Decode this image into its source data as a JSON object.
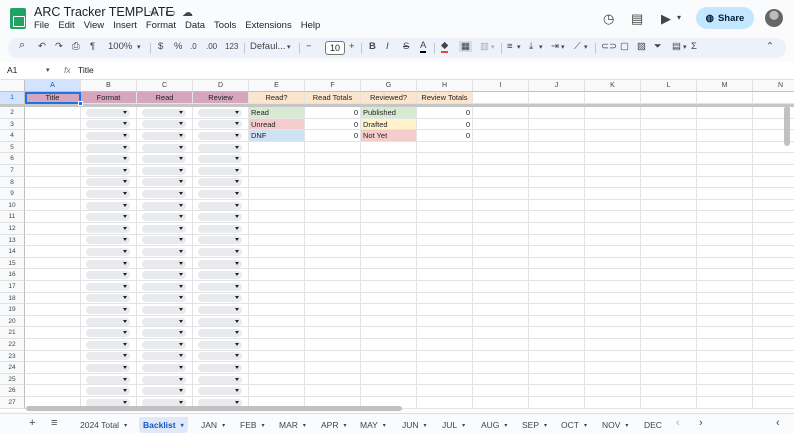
{
  "app": {
    "title": "ARC Tracker TEMPLATE",
    "menu": [
      "File",
      "Edit",
      "View",
      "Insert",
      "Format",
      "Data",
      "Tools",
      "Extensions",
      "Help"
    ],
    "share_label": "Share"
  },
  "icons": {
    "star": "☆",
    "folder": "▭",
    "cloud": "☁",
    "history": "◷",
    "comment": "▤",
    "video": "▶",
    "globe": "◍",
    "search": "⌕",
    "undo": "↶",
    "redo": "↷",
    "print": "⎙",
    "paint_format": "¶",
    "chevron_down": "▾",
    "chevron_up": "⌃",
    "chevron_left": "‹",
    "chevron_right": "›",
    "menu": "≡",
    "plus": "+"
  },
  "toolbar": {
    "zoom": "100%",
    "currency": "$",
    "percent": "%",
    "decimal_decrease": ".0",
    "decimal_increase": ".00",
    "number_format": "123",
    "font": "Defaul...",
    "font_size": "10",
    "minus": "−",
    "plus": "+",
    "bold": "B",
    "italic": "I",
    "strike": "S",
    "text_color": "A",
    "sum": "Σ"
  },
  "formula_bar": {
    "cell_ref": "A1",
    "fx": "fx",
    "content": "Title"
  },
  "grid": {
    "columns": [
      "A",
      "B",
      "C",
      "D",
      "E",
      "F",
      "G",
      "H",
      "I",
      "J",
      "K",
      "L",
      "M",
      "N"
    ],
    "rows": [
      "1",
      "2",
      "3",
      "4",
      "5",
      "6",
      "7",
      "8",
      "9",
      "10",
      "11",
      "12",
      "13",
      "14",
      "15",
      "16",
      "17",
      "18",
      "19",
      "20",
      "21",
      "22",
      "23",
      "24",
      "25",
      "26",
      "27"
    ],
    "headers": {
      "A": "Title",
      "B": "Format",
      "C": "Read",
      "D": "Review",
      "E": "Read?",
      "F": "Read Totals",
      "G": "Reviewed?",
      "H": "Review Totals"
    },
    "status": [
      {
        "label": "Read",
        "total": "0",
        "review_label": "Published",
        "review_total": "0"
      },
      {
        "label": "Unread",
        "total": "0",
        "review_label": "Drafted",
        "review_total": "0"
      },
      {
        "label": "DNF",
        "total": "0",
        "review_label": "Not Yet",
        "review_total": "0"
      }
    ]
  },
  "colors": {
    "hdr_purple": "#d5a6bd",
    "hdr_peach": "#fce5cd",
    "read_green": "#d9ead3",
    "unread_red": "#f4cccc",
    "dnf_blue": "#cfe2f3",
    "published_green": "#d9ead3",
    "drafted_yellow": "#fff2cc",
    "notyet_red": "#f4cccc"
  },
  "tabs": {
    "items": [
      "2024 Total",
      "Backlist",
      "JAN",
      "FEB",
      "MAR",
      "APR",
      "MAY",
      "JUN",
      "JUL",
      "AUG",
      "SEP",
      "OCT",
      "NOV",
      "DEC"
    ],
    "active": "Backlist"
  }
}
